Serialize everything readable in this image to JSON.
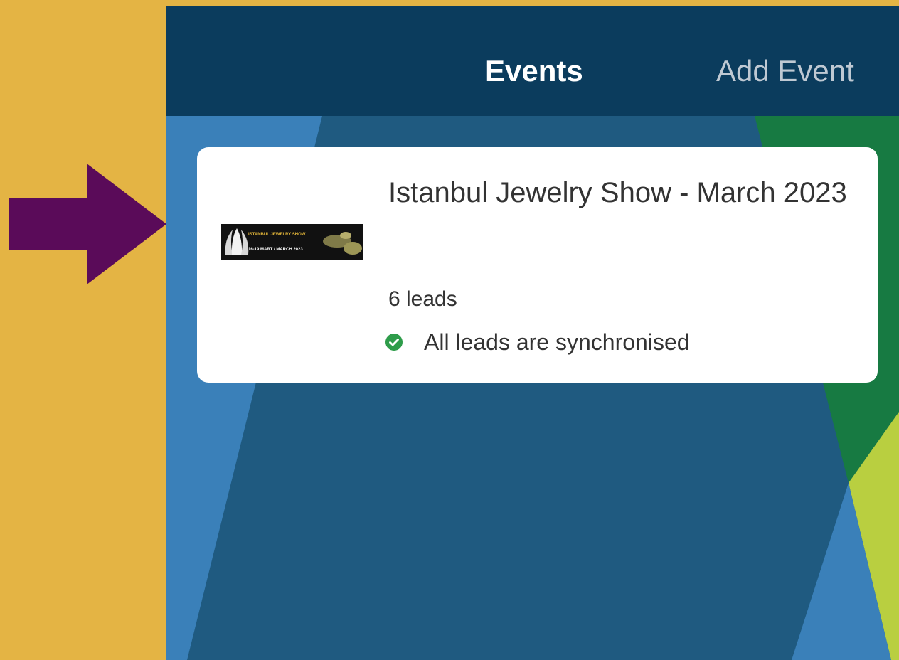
{
  "theme": {
    "page_background": "#e4b444",
    "arrow_color": "#5a0b59",
    "navbar_background": "#0b3c5d",
    "active_tab_color": "#ffffff",
    "inactive_tab_color": "#bfc9d3",
    "card_background": "#ffffff",
    "status_success": "#2e9c4a"
  },
  "annotation": {
    "icon": "right-arrow-icon"
  },
  "navbar": {
    "tabs": [
      {
        "label": "Events",
        "active": true
      },
      {
        "label": "Add Event",
        "active": false
      }
    ]
  },
  "events": [
    {
      "title": "Istanbul Jewelry Show - March 2023",
      "leads_label": "6 leads",
      "sync_status": "All leads are synchronised",
      "sync_icon": "check-circle-icon",
      "thumbnail": {
        "title": "ISTANBUL JEWELRY SHOW",
        "dates": "16-19 MART / MARCH 2023"
      }
    }
  ]
}
